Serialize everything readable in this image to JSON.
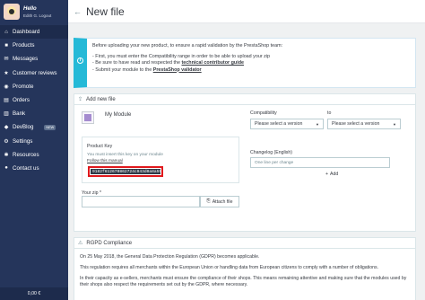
{
  "user": {
    "greeting": "Hello",
    "meta": "Edith G.  Logout"
  },
  "sidebar": {
    "items": [
      {
        "label": "Dashboard",
        "icon": "home-icon"
      },
      {
        "label": "Products",
        "icon": "box-icon"
      },
      {
        "label": "Messages",
        "icon": "envelope-icon"
      },
      {
        "label": "Customer reviews",
        "icon": "star-icon"
      },
      {
        "label": "Promote",
        "icon": "bullhorn-icon"
      },
      {
        "label": "Orders",
        "icon": "cart-icon"
      },
      {
        "label": "Bank",
        "icon": "bank-icon"
      },
      {
        "label": "DevBlog",
        "icon": "dropbox-icon",
        "badge": "NEW"
      },
      {
        "label": "Settings",
        "icon": "gear-icon"
      },
      {
        "label": "Resources",
        "icon": "support-icon"
      },
      {
        "label": "Contact us",
        "icon": "contact-icon"
      }
    ],
    "cart_total": "0,00 €"
  },
  "header": {
    "title": "New file"
  },
  "info": {
    "intro": "Before uploading your new product, to ensure a rapid validation by the PrestaShop team:",
    "line1": "- First, you must enter the Compatibility range in order to be able to upload your zip",
    "line2_prefix": "- Be sure to have read and respected the ",
    "line2_link": "technical contributor guide",
    "line3_prefix": "- Submit your module to the ",
    "line3_link": "PrestaShop validator"
  },
  "add_card": {
    "title": "Add new file",
    "module_name": "My Module",
    "product_key_label": "Product Key",
    "product_key_help": "You must insert this key on your module",
    "follow_manual": "Follow this manual",
    "product_key_value": "9182f612670862724c943d0a8a5972",
    "zip_label": "Your zip *",
    "attach_label": "Attach file",
    "compatibility_label": "Compatibility",
    "to_label": "to",
    "select_placeholder": "Please select a version",
    "changelog_label": "Changelog (English)",
    "changelog_placeholder": "One line per change",
    "add_label": "Add"
  },
  "rgpd": {
    "title": "RGPD Compliance",
    "p1": "On 25 May 2018, the General Data Protection Regulation (GDPR) becomes applicable.",
    "p2": "This regulation requires all merchants within the European Union or handling data from European citizens to comply with a number of obligations.",
    "p3": "In their capacity as e-sellers, merchants must ensure the compliance of their shops. This means remaining attentive and making sure that the modules used by their shops also respect the requirements set out by the GDPR, where necessary."
  }
}
